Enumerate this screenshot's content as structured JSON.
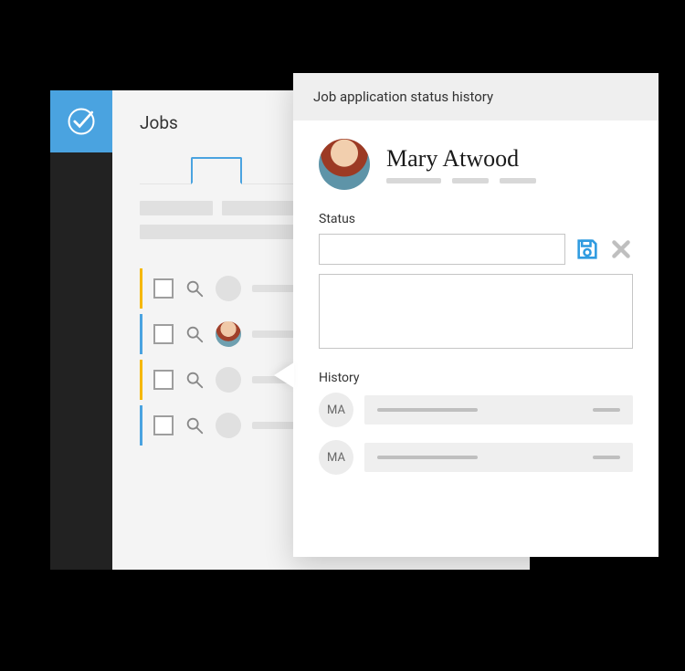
{
  "jobs": {
    "title": "Jobs",
    "rows": [
      {
        "accent": "yellow",
        "has_avatar": false
      },
      {
        "accent": "blue",
        "has_avatar": true
      },
      {
        "accent": "yellow",
        "has_avatar": false
      },
      {
        "accent": "blue",
        "has_avatar": false
      }
    ]
  },
  "detail": {
    "header": "Job application status history",
    "applicant_name": "Mary Atwood",
    "status_label": "Status",
    "status_value": "",
    "notes_value": "",
    "history_label": "History",
    "history": [
      {
        "initials": "MA"
      },
      {
        "initials": "MA"
      }
    ]
  },
  "icons": {
    "logo": "check-circle",
    "save": "save-icon",
    "cancel": "close-icon",
    "search": "search-icon"
  }
}
